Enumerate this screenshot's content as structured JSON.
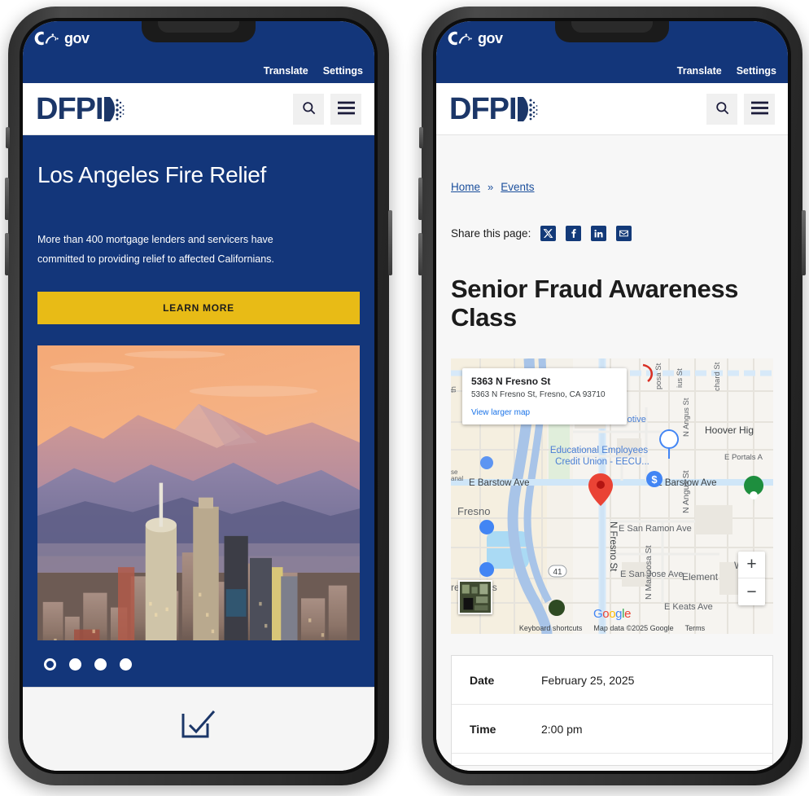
{
  "colors": {
    "ca_blue": "#13367a",
    "dfpi_navy": "#1b3668",
    "gold": "#e8bb16",
    "link_blue": "#1b4f9c",
    "page_bg": "#f7f7f7"
  },
  "statebar": {
    "logo_text": "gov",
    "logo_mark": "ca-state-logo",
    "links": [
      {
        "label": "Translate",
        "name": "translate-link"
      },
      {
        "label": "Settings",
        "name": "settings-link"
      }
    ]
  },
  "header": {
    "brand": "DFPI",
    "search_icon": "search-icon",
    "menu_icon": "hamburger-menu-icon"
  },
  "left_phone": {
    "hero": {
      "title": "Los Angeles Fire Relief",
      "body": "More than 400 mortgage lenders and servicers have committed to providing relief to affected Californians.",
      "cta_label": "LEARN MORE",
      "image_alt": "los-angeles-skyline-sunset"
    },
    "carousel": {
      "total": 4,
      "active_index": 0,
      "dots": [
        "slide-1",
        "slide-2",
        "slide-3",
        "slide-4"
      ]
    },
    "footer_icon": "newsletter-signup-icon"
  },
  "right_phone": {
    "breadcrumb": {
      "items": [
        "Home",
        "Events"
      ],
      "separator": "»"
    },
    "share": {
      "label": "Share this page:",
      "networks": [
        "x-twitter",
        "facebook",
        "linkedin",
        "email"
      ]
    },
    "page_title": "Senior Fraud Awareness Class",
    "map": {
      "info_card": {
        "title": "5363 N Fresno St",
        "address": "5363 N Fresno St, Fresno, CA 93710",
        "link_label": "View larger map"
      },
      "zoom_in": "+",
      "zoom_out": "−",
      "brand": "Google",
      "attribution": [
        "Keyboard shortcuts",
        "Map data ©2025 Google",
        "Terms"
      ],
      "labels": [
        "posa St",
        "ius St",
        "chard St",
        "Hoover Hig",
        "N Angus St",
        "E Portals A",
        "E Barstow Ave",
        "Educational Employees",
        "Credit Union - EECU...",
        "Elma Fresno Automotive",
        "N Fresno St",
        "E San Ramon Ave",
        "E San Jose Ave",
        "Element",
        "N Mariposa St",
        "E Keats Ave",
        "Wolte",
        "he",
        "Fresno",
        "re for Less",
        "anal",
        "41",
        "th"
      ]
    },
    "details": {
      "rows": [
        {
          "key": "Date",
          "value": "February 25, 2025"
        },
        {
          "key": "Time",
          "value": "2:00 pm"
        }
      ]
    }
  }
}
